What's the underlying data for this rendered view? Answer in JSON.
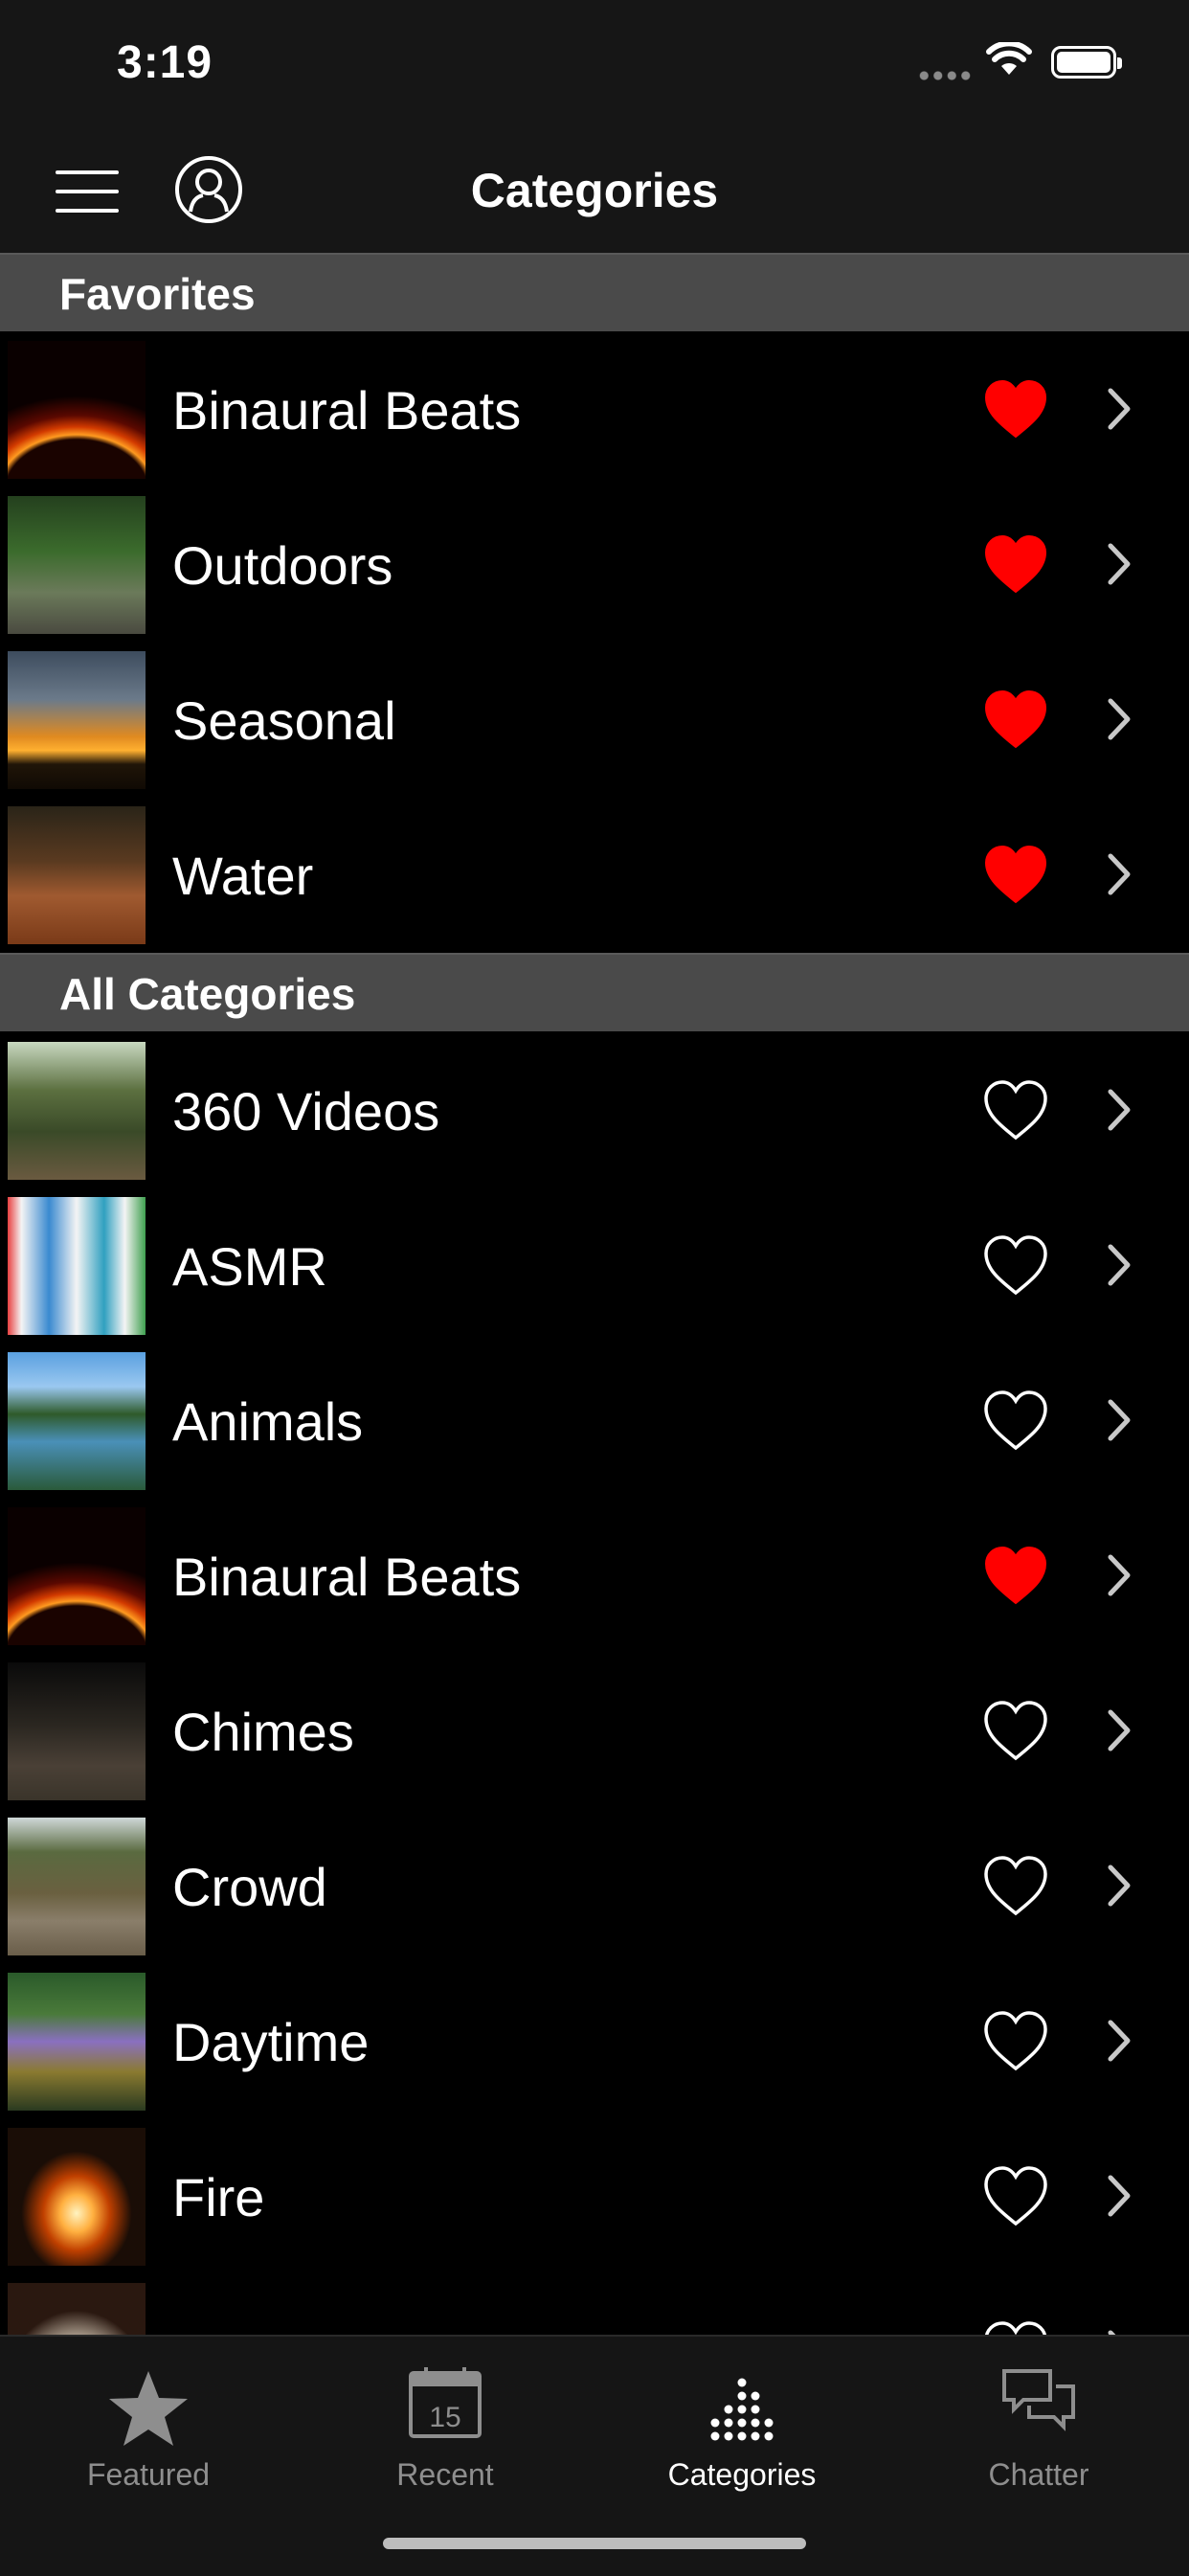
{
  "status": {
    "time": "3:19"
  },
  "navbar": {
    "title": "Categories"
  },
  "favorites": {
    "header": "Favorites",
    "items": [
      {
        "label": "Binaural Beats",
        "favorited": true,
        "thumb": "sun-flare"
      },
      {
        "label": "Outdoors",
        "favorited": true,
        "thumb": "forest-railroad"
      },
      {
        "label": "Seasonal",
        "favorited": true,
        "thumb": "storm-sunset"
      },
      {
        "label": "Water",
        "favorited": true,
        "thumb": "stream-forest"
      }
    ]
  },
  "all": {
    "header": "All Categories",
    "items": [
      {
        "label": "360 Videos",
        "favorited": false,
        "thumb": "forest-bridge"
      },
      {
        "label": "ASMR",
        "favorited": false,
        "thumb": "chip-bags"
      },
      {
        "label": "Animals",
        "favorited": false,
        "thumb": "lake-trees"
      },
      {
        "label": "Binaural Beats",
        "favorited": true,
        "thumb": "sun-flare"
      },
      {
        "label": "Chimes",
        "favorited": false,
        "thumb": "night-flag"
      },
      {
        "label": "Crowd",
        "favorited": false,
        "thumb": "wooden-deck"
      },
      {
        "label": "Daytime",
        "favorited": false,
        "thumb": "garden-fountain"
      },
      {
        "label": "Fire",
        "favorited": false,
        "thumb": "campfire"
      },
      {
        "label": "",
        "favorited": false,
        "thumb": "partial"
      }
    ]
  },
  "tabs": [
    {
      "label": "Featured",
      "icon": "star-icon",
      "active": false
    },
    {
      "label": "Recent",
      "icon": "calendar-icon",
      "active": false,
      "badge": "15"
    },
    {
      "label": "Categories",
      "icon": "categories-icon",
      "active": true
    },
    {
      "label": "Chatter",
      "icon": "chat-icon",
      "active": false
    }
  ],
  "colors": {
    "heart_active": "#ff0000",
    "section_bg": "#4a4a4a",
    "bar_bg": "#161616"
  }
}
